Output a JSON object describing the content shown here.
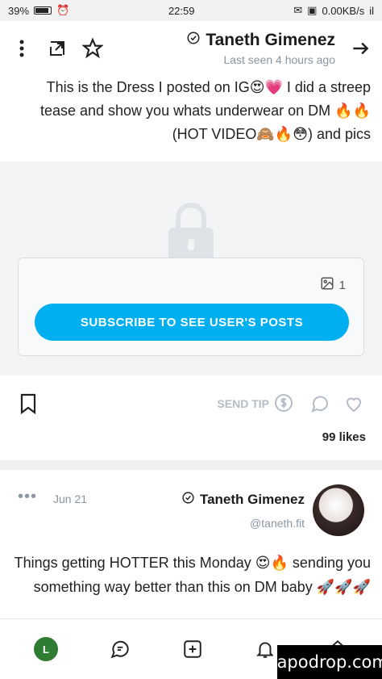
{
  "status_bar": {
    "battery": "39%",
    "time": "22:59",
    "net_speed": "0.00KB/s",
    "signal": "il"
  },
  "header": {
    "title": "Taneth Gimenez",
    "subtitle": "Last seen 4 hours ago",
    "icons": [
      "back-arrow-icon",
      "star-icon",
      "share-icon",
      "more-vertical-icon",
      "verified-icon"
    ]
  },
  "post1": {
    "text": "This is the Dress I posted on IG😍💗 I did a streep tease and show you whats underwear on DM 🔥🔥 (HOT VIDEO🙈🔥😳) and pics",
    "media_count": "1",
    "subscribe_label": "SUBSCRIBE TO SEE USER'S POSTS",
    "send_tip_label": "SEND TIP",
    "likes": "99 likes"
  },
  "post2": {
    "author": "Taneth Gimenez",
    "handle": "@taneth.fit",
    "date": "Jun 21",
    "text": "Things getting HOTTER this Monday 😍🔥 sending you something way better than this on DM baby 🚀🚀🚀"
  },
  "bottom_nav": {
    "user_initial": "L",
    "items": [
      "home-icon",
      "notifications-icon",
      "add-post-icon",
      "messages-icon",
      "user-avatar"
    ]
  },
  "watermark": "fapodrop.com",
  "colors": {
    "accent": "#00aff0",
    "muted": "#8a96a3",
    "locked_bg": "#f3f4f6",
    "avatar_green": "#2e7d32"
  }
}
